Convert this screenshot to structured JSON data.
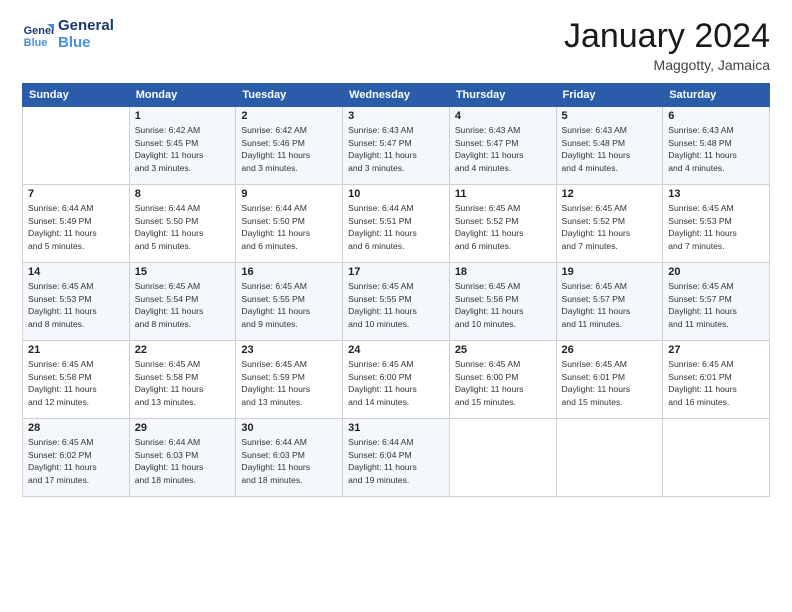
{
  "logo": {
    "line1": "General",
    "line2": "Blue"
  },
  "title": "January 2024",
  "location": "Maggotty, Jamaica",
  "days_header": [
    "Sunday",
    "Monday",
    "Tuesday",
    "Wednesday",
    "Thursday",
    "Friday",
    "Saturday"
  ],
  "weeks": [
    [
      {
        "day": "",
        "info": ""
      },
      {
        "day": "1",
        "info": "Sunrise: 6:42 AM\nSunset: 5:45 PM\nDaylight: 11 hours\nand 3 minutes."
      },
      {
        "day": "2",
        "info": "Sunrise: 6:42 AM\nSunset: 5:46 PM\nDaylight: 11 hours\nand 3 minutes."
      },
      {
        "day": "3",
        "info": "Sunrise: 6:43 AM\nSunset: 5:47 PM\nDaylight: 11 hours\nand 3 minutes."
      },
      {
        "day": "4",
        "info": "Sunrise: 6:43 AM\nSunset: 5:47 PM\nDaylight: 11 hours\nand 4 minutes."
      },
      {
        "day": "5",
        "info": "Sunrise: 6:43 AM\nSunset: 5:48 PM\nDaylight: 11 hours\nand 4 minutes."
      },
      {
        "day": "6",
        "info": "Sunrise: 6:43 AM\nSunset: 5:48 PM\nDaylight: 11 hours\nand 4 minutes."
      }
    ],
    [
      {
        "day": "7",
        "info": "Sunrise: 6:44 AM\nSunset: 5:49 PM\nDaylight: 11 hours\nand 5 minutes."
      },
      {
        "day": "8",
        "info": "Sunrise: 6:44 AM\nSunset: 5:50 PM\nDaylight: 11 hours\nand 5 minutes."
      },
      {
        "day": "9",
        "info": "Sunrise: 6:44 AM\nSunset: 5:50 PM\nDaylight: 11 hours\nand 6 minutes."
      },
      {
        "day": "10",
        "info": "Sunrise: 6:44 AM\nSunset: 5:51 PM\nDaylight: 11 hours\nand 6 minutes."
      },
      {
        "day": "11",
        "info": "Sunrise: 6:45 AM\nSunset: 5:52 PM\nDaylight: 11 hours\nand 6 minutes."
      },
      {
        "day": "12",
        "info": "Sunrise: 6:45 AM\nSunset: 5:52 PM\nDaylight: 11 hours\nand 7 minutes."
      },
      {
        "day": "13",
        "info": "Sunrise: 6:45 AM\nSunset: 5:53 PM\nDaylight: 11 hours\nand 7 minutes."
      }
    ],
    [
      {
        "day": "14",
        "info": "Sunrise: 6:45 AM\nSunset: 5:53 PM\nDaylight: 11 hours\nand 8 minutes."
      },
      {
        "day": "15",
        "info": "Sunrise: 6:45 AM\nSunset: 5:54 PM\nDaylight: 11 hours\nand 8 minutes."
      },
      {
        "day": "16",
        "info": "Sunrise: 6:45 AM\nSunset: 5:55 PM\nDaylight: 11 hours\nand 9 minutes."
      },
      {
        "day": "17",
        "info": "Sunrise: 6:45 AM\nSunset: 5:55 PM\nDaylight: 11 hours\nand 10 minutes."
      },
      {
        "day": "18",
        "info": "Sunrise: 6:45 AM\nSunset: 5:56 PM\nDaylight: 11 hours\nand 10 minutes."
      },
      {
        "day": "19",
        "info": "Sunrise: 6:45 AM\nSunset: 5:57 PM\nDaylight: 11 hours\nand 11 minutes."
      },
      {
        "day": "20",
        "info": "Sunrise: 6:45 AM\nSunset: 5:57 PM\nDaylight: 11 hours\nand 11 minutes."
      }
    ],
    [
      {
        "day": "21",
        "info": "Sunrise: 6:45 AM\nSunset: 5:58 PM\nDaylight: 11 hours\nand 12 minutes."
      },
      {
        "day": "22",
        "info": "Sunrise: 6:45 AM\nSunset: 5:58 PM\nDaylight: 11 hours\nand 13 minutes."
      },
      {
        "day": "23",
        "info": "Sunrise: 6:45 AM\nSunset: 5:59 PM\nDaylight: 11 hours\nand 13 minutes."
      },
      {
        "day": "24",
        "info": "Sunrise: 6:45 AM\nSunset: 6:00 PM\nDaylight: 11 hours\nand 14 minutes."
      },
      {
        "day": "25",
        "info": "Sunrise: 6:45 AM\nSunset: 6:00 PM\nDaylight: 11 hours\nand 15 minutes."
      },
      {
        "day": "26",
        "info": "Sunrise: 6:45 AM\nSunset: 6:01 PM\nDaylight: 11 hours\nand 15 minutes."
      },
      {
        "day": "27",
        "info": "Sunrise: 6:45 AM\nSunset: 6:01 PM\nDaylight: 11 hours\nand 16 minutes."
      }
    ],
    [
      {
        "day": "28",
        "info": "Sunrise: 6:45 AM\nSunset: 6:02 PM\nDaylight: 11 hours\nand 17 minutes."
      },
      {
        "day": "29",
        "info": "Sunrise: 6:44 AM\nSunset: 6:03 PM\nDaylight: 11 hours\nand 18 minutes."
      },
      {
        "day": "30",
        "info": "Sunrise: 6:44 AM\nSunset: 6:03 PM\nDaylight: 11 hours\nand 18 minutes."
      },
      {
        "day": "31",
        "info": "Sunrise: 6:44 AM\nSunset: 6:04 PM\nDaylight: 11 hours\nand 19 minutes."
      },
      {
        "day": "",
        "info": ""
      },
      {
        "day": "",
        "info": ""
      },
      {
        "day": "",
        "info": ""
      }
    ]
  ]
}
